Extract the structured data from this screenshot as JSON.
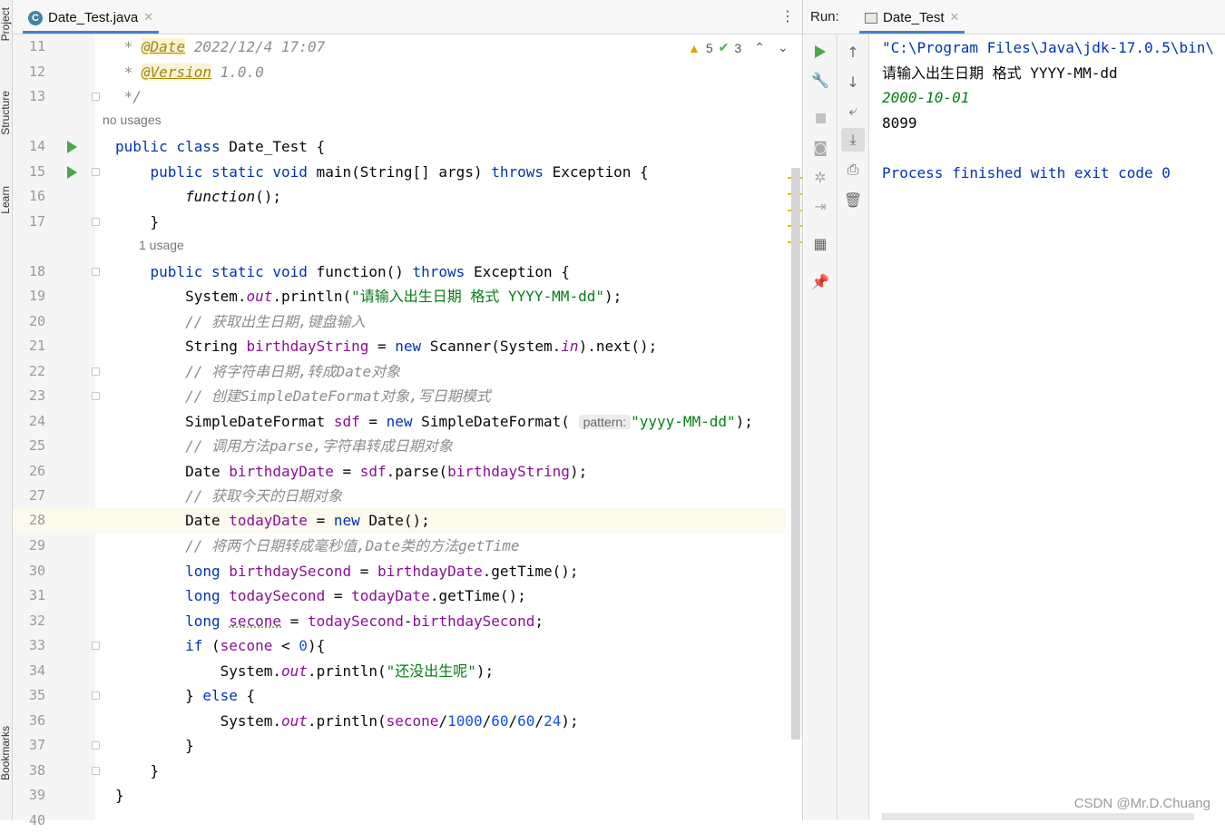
{
  "side_panels": [
    "Project",
    "Structure",
    "Learn",
    "Bookmarks"
  ],
  "editor": {
    "tab_name": "Date_Test.java",
    "tab_icon": "C",
    "inspections": {
      "warnings": "5",
      "checks": "3"
    },
    "usage_hints": [
      "no usages",
      "1 usage"
    ],
    "parameter_hint": "pattern:",
    "line_numbers": [
      "11",
      "12",
      "13",
      "14",
      "15",
      "16",
      "17",
      "18",
      "19",
      "20",
      "21",
      "22",
      "23",
      "24",
      "25",
      "26",
      "27",
      "28",
      "29",
      "30",
      "31",
      "32",
      "33",
      "34",
      "35",
      "36",
      "37",
      "38",
      "39",
      "40"
    ],
    "tokens": {
      "t11a": " * ",
      "t11b": "@Date",
      "t11c": " 2022/12/4 17:07",
      "t12a": " * ",
      "t12b": "@Version",
      "t12c": " 1.0.0",
      "t13": " */",
      "t14a": "public class",
      "t14b": " Date_Test {",
      "t15a": "    public static void",
      "t15b": " main(String[] args) ",
      "t15c": "throws",
      "t15d": " Exception {",
      "t16a": "        ",
      "t16b": "function",
      "t16c": "();",
      "t17": "    }",
      "t18a": "    public static void",
      "t18b": " function() ",
      "t18c": "throws",
      "t18d": " Exception {",
      "t19a": "        System.",
      "t19b": "out",
      "t19c": ".println(",
      "t19d": "\"请输入出生日期 格式 YYYY-MM-dd\"",
      "t19e": ");",
      "t20": "        // 获取出生日期,键盘输入",
      "t21a": "        String ",
      "t21b": "birthdayString",
      "t21c": " = ",
      "t21d": "new",
      "t21e": " Scanner(System.",
      "t21f": "in",
      "t21g": ").next();",
      "t22": "        // 将字符串日期,转成Date对象",
      "t23": "        // 创建SimpleDateFormat对象,写日期模式",
      "t24a": "        SimpleDateFormat ",
      "t24b": "sdf",
      "t24c": " = ",
      "t24d": "new",
      "t24e": " SimpleDateFormat( ",
      "t24g": "\"yyyy-MM-dd\"",
      "t24h": ");",
      "t25": "        // 调用方法parse,字符串转成日期对象",
      "t26a": "        Date ",
      "t26b": "birthdayDate",
      "t26c": " = ",
      "t26d": "sdf",
      "t26e": ".parse(",
      "t26f": "birthdayString",
      "t26g": ");",
      "t27": "        // 获取今天的日期对象",
      "t28a": "        Date ",
      "t28b": "todayDate",
      "t28c": " = ",
      "t28d": "new",
      "t28e": " Date();",
      "t29": "        // 将两个日期转成毫秒值,Date类的方法getTime",
      "t30a": "        long ",
      "t30b": "birthdaySecond",
      "t30c": " = ",
      "t30d": "birthdayDate",
      "t30e": ".getTime();",
      "t31a": "        long ",
      "t31b": "todaySecond",
      "t31c": " = ",
      "t31d": "todayDate",
      "t31e": ".getTime();",
      "t32a": "        long ",
      "t32b": "secone",
      "t32c": " = ",
      "t32d": "todaySecond",
      "t32e": "-",
      "t32f": "birthdaySecond",
      "t32g": ";",
      "t33a": "        if",
      "t33b": " (",
      "t33c": "secone",
      "t33d": " < ",
      "t33e": "0",
      "t33f": "){",
      "t34a": "            System.",
      "t34b": "out",
      "t34c": ".println(",
      "t34d": "\"还没出生呢\"",
      "t34e": ");",
      "t35a": "        } ",
      "t35b": "else",
      "t35c": " {",
      "t36a": "            System.",
      "t36b": "out",
      "t36c": ".println(",
      "t36d": "secone",
      "t36e": "/",
      "t36f": "1000",
      "t36g": "/",
      "t36h": "60",
      "t36i": "/",
      "t36j": "60",
      "t36k": "/",
      "t36l": "24",
      "t36m": ");",
      "t37": "        }",
      "t38": "    }",
      "t39": "}"
    }
  },
  "run": {
    "label": "Run:",
    "tab_name": "Date_Test",
    "console": {
      "cmd": "\"C:\\Program Files\\Java\\jdk-17.0.5\\bin\\",
      "prompt": "请输入出生日期 格式 YYYY-MM-dd",
      "input": "2000-10-01",
      "output": "8099",
      "finished": "Process finished with exit code 0"
    }
  },
  "watermark": "CSDN @Mr.D.Chuang",
  "colors": {
    "keyword": "#0033b3",
    "string": "#067d17",
    "comment": "#8c8c8c",
    "field": "#871094",
    "number": "#1750eb",
    "accent": "#4083c9"
  }
}
